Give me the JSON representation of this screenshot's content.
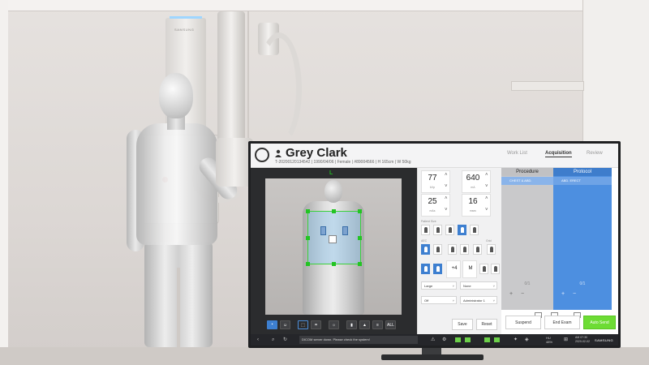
{
  "stand": {
    "brand": "SAMSUNG"
  },
  "patient": {
    "name": "Grey Clark",
    "id": "T-20200120134542",
    "dob": "1990/04/06",
    "sex": "Female",
    "accession": "#89004566",
    "height": "H 165cm",
    "weight": "W 50kg"
  },
  "nav": {
    "worklist": "Work List",
    "acquisition": "Acquisition",
    "review": "Review",
    "active": "Acquisition"
  },
  "viewer": {
    "marker": "L",
    "toolbar": [
      "camera-icon",
      "face-icon",
      "collimate-icon",
      "crop-icon",
      "brightness-icon",
      "patient-icon",
      "positioning-icon",
      "filter-icon",
      "ALL"
    ],
    "all_label": "ALL"
  },
  "exposure": {
    "kvp": {
      "value": "77",
      "unit": "kVp"
    },
    "ma": {
      "value": "640",
      "unit": "mA"
    },
    "mas": {
      "value": "25",
      "unit": "mAs"
    },
    "ms": {
      "value": "16",
      "unit": "msec"
    }
  },
  "panel": {
    "patient_size_label": "Patient Size",
    "sizes": [
      "Obj",
      "Infant",
      "Small",
      "Medium",
      "Large"
    ],
    "dropdown_size": "Large",
    "dropdown_none": "None",
    "dropdown_off": "Off",
    "dropdown_admin": "Administrator 1",
    "aec_label": "AEC",
    "sid_label": "SID",
    "grid_label": "Grid",
    "density_value": "+4",
    "sid_value": "M",
    "save": "Save",
    "reset": "Reset"
  },
  "procedure": {
    "header": "Procedure",
    "row": "CHEST & ABD.",
    "pager": "0/1"
  },
  "protocol": {
    "header": "Protocol",
    "row": "ABD. ERECT",
    "pager": "0/1"
  },
  "actions": {
    "suspend": "Suspend",
    "end_exam": "End Exam",
    "auto_send": "Auto Send"
  },
  "status": {
    "message": "DICOM server down. Please check the system!",
    "hu": "HU",
    "hu_value": "48%",
    "clock_time": "AM 07:30",
    "clock_date": "2020-02-02",
    "brand": "SAMSUNG"
  },
  "colors": {
    "accent": "#4d8fe0",
    "ok_green": "#6ddc34",
    "roi_green": "#23c423"
  }
}
